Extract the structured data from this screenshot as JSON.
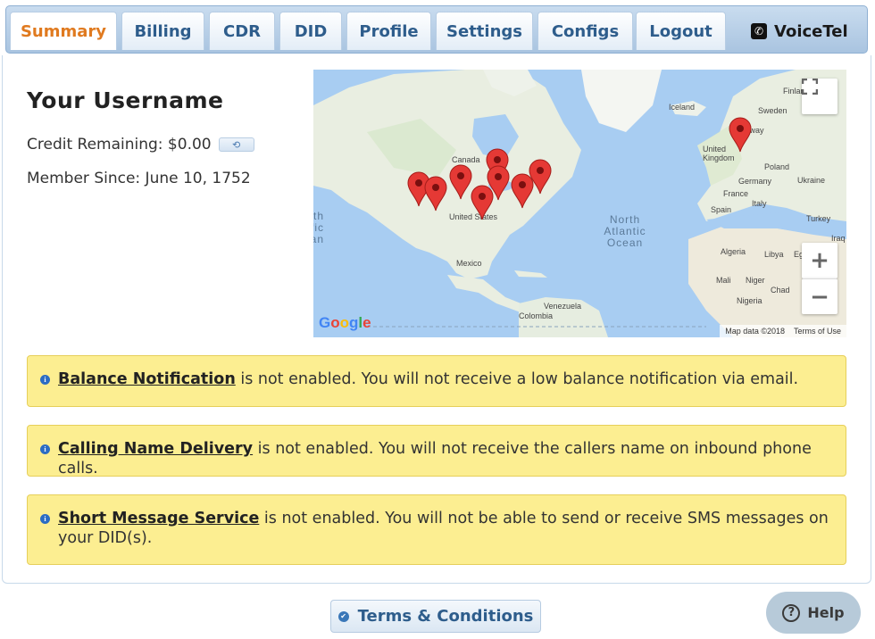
{
  "nav": {
    "tabs": [
      {
        "label": "Summary",
        "active": true
      },
      {
        "label": "Billing"
      },
      {
        "label": "CDR"
      },
      {
        "label": "DID"
      },
      {
        "label": "Profile"
      },
      {
        "label": "Settings"
      },
      {
        "label": "Configs"
      },
      {
        "label": "Logout"
      }
    ],
    "brand": "VoiceTel",
    "brand_icon": "phone-icon"
  },
  "account": {
    "username": "Your Username",
    "credit_label": "Credit Remaining: $0.00",
    "refresh_icon": "refresh-icon",
    "member_since": "Member Since: June 10, 1752"
  },
  "map": {
    "labels": {
      "canada": "Canada",
      "united_states": "United States",
      "mexico": "Mexico",
      "venezuela": "Venezuela",
      "colombia": "Colombia",
      "iceland": "Iceland",
      "finland": "Finland",
      "sweden": "Sweden",
      "norway": "Norway",
      "united_kingdom": "United Kingdom",
      "poland": "Poland",
      "germany": "Germany",
      "ukraine": "Ukraine",
      "france": "France",
      "italy": "Italy",
      "spain": "Spain",
      "turkey": "Turkey",
      "iraq": "Iraq",
      "algeria": "Algeria",
      "libya": "Libya",
      "egypt": "Egypt",
      "mali": "Mali",
      "niger": "Niger",
      "chad": "Chad",
      "nigeria": "Nigeria",
      "north_atlantic_ocean": "North Atlantic Ocean",
      "north_pacific_ocean": "North Pacific Ocean"
    },
    "google_logo": "Google",
    "map_data": "Map data ©2018",
    "terms_of_use": "Terms of Use",
    "zoom_in": "+",
    "zoom_out": "−",
    "marker_count": 10
  },
  "notices": [
    {
      "feature": "Balance Notification",
      "text": " is not enabled. You will not receive a low balance notification via email."
    },
    {
      "feature": "Calling Name Delivery",
      "text": " is not enabled. You will not receive the callers name on inbound phone calls."
    },
    {
      "feature": "Short Message Service",
      "text": " is not enabled. You will not be able to send or receive SMS messages on your DID(s)."
    }
  ],
  "footer": {
    "terms_label": "Terms & Conditions",
    "help_label": "Help"
  },
  "colors": {
    "accent_active_tab": "#e07a1f",
    "tab_text": "#2e5d8c",
    "notice_bg": "#fcee91",
    "marker": "#e53935"
  }
}
